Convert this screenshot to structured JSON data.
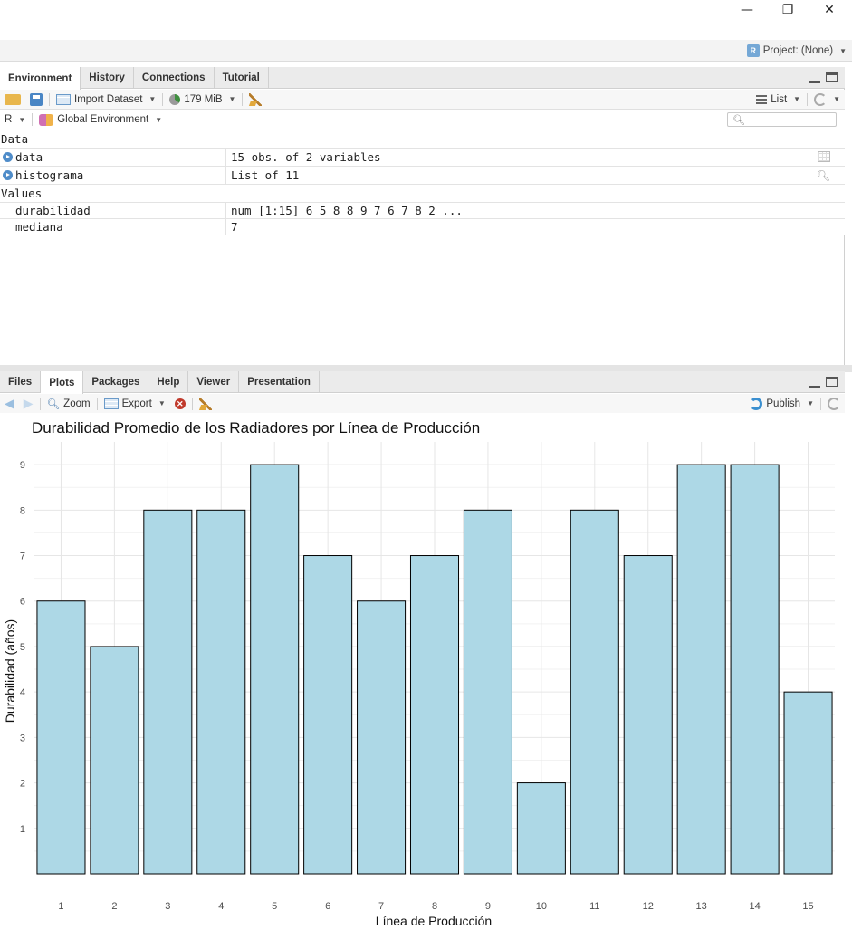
{
  "window": {
    "minimize_glyph": "—",
    "maximize_glyph": "❐",
    "close_glyph": "✕"
  },
  "project": {
    "label": "Project: (None)"
  },
  "env_pane": {
    "tabs": [
      "Environment",
      "History",
      "Connections",
      "Tutorial"
    ],
    "toolbar": {
      "import_label": "Import Dataset",
      "memory_label": "179 MiB",
      "view_label": "List",
      "lang_label": "R",
      "env_label": "Global Environment"
    },
    "sections": {
      "data_header": "Data",
      "values_header": "Values"
    },
    "data_rows": [
      {
        "name": "data",
        "value": "15 obs. of 2 variables"
      },
      {
        "name": "histograma",
        "value": "List of  11"
      }
    ],
    "value_rows": [
      {
        "name": "durabilidad",
        "value": "num [1:15] 6 5 8 8 9 7 6 7 8 2 ..."
      },
      {
        "name": "mediana",
        "value": "7"
      }
    ]
  },
  "plots_pane": {
    "tabs": [
      "Files",
      "Plots",
      "Packages",
      "Help",
      "Viewer",
      "Presentation"
    ],
    "toolbar": {
      "zoom_label": "Zoom",
      "export_label": "Export",
      "publish_label": "Publish"
    }
  },
  "chart_data": {
    "type": "bar",
    "title": "Durabilidad Promedio de los Radiadores por Línea de Producción",
    "xlabel": "Línea de Producción",
    "ylabel": "Durabilidad (años)",
    "categories": [
      "1",
      "2",
      "3",
      "4",
      "5",
      "6",
      "7",
      "8",
      "9",
      "10",
      "11",
      "12",
      "13",
      "14",
      "15"
    ],
    "values": [
      6,
      5,
      8,
      8,
      9,
      7,
      6,
      7,
      8,
      2,
      8,
      7,
      9,
      9,
      4
    ],
    "ylim": [
      0,
      9.5
    ],
    "yticks": [
      1,
      2,
      3,
      4,
      5,
      6,
      7,
      8,
      9
    ],
    "bar_color": "#add8e6",
    "bar_border": "#000000",
    "grid": true
  }
}
